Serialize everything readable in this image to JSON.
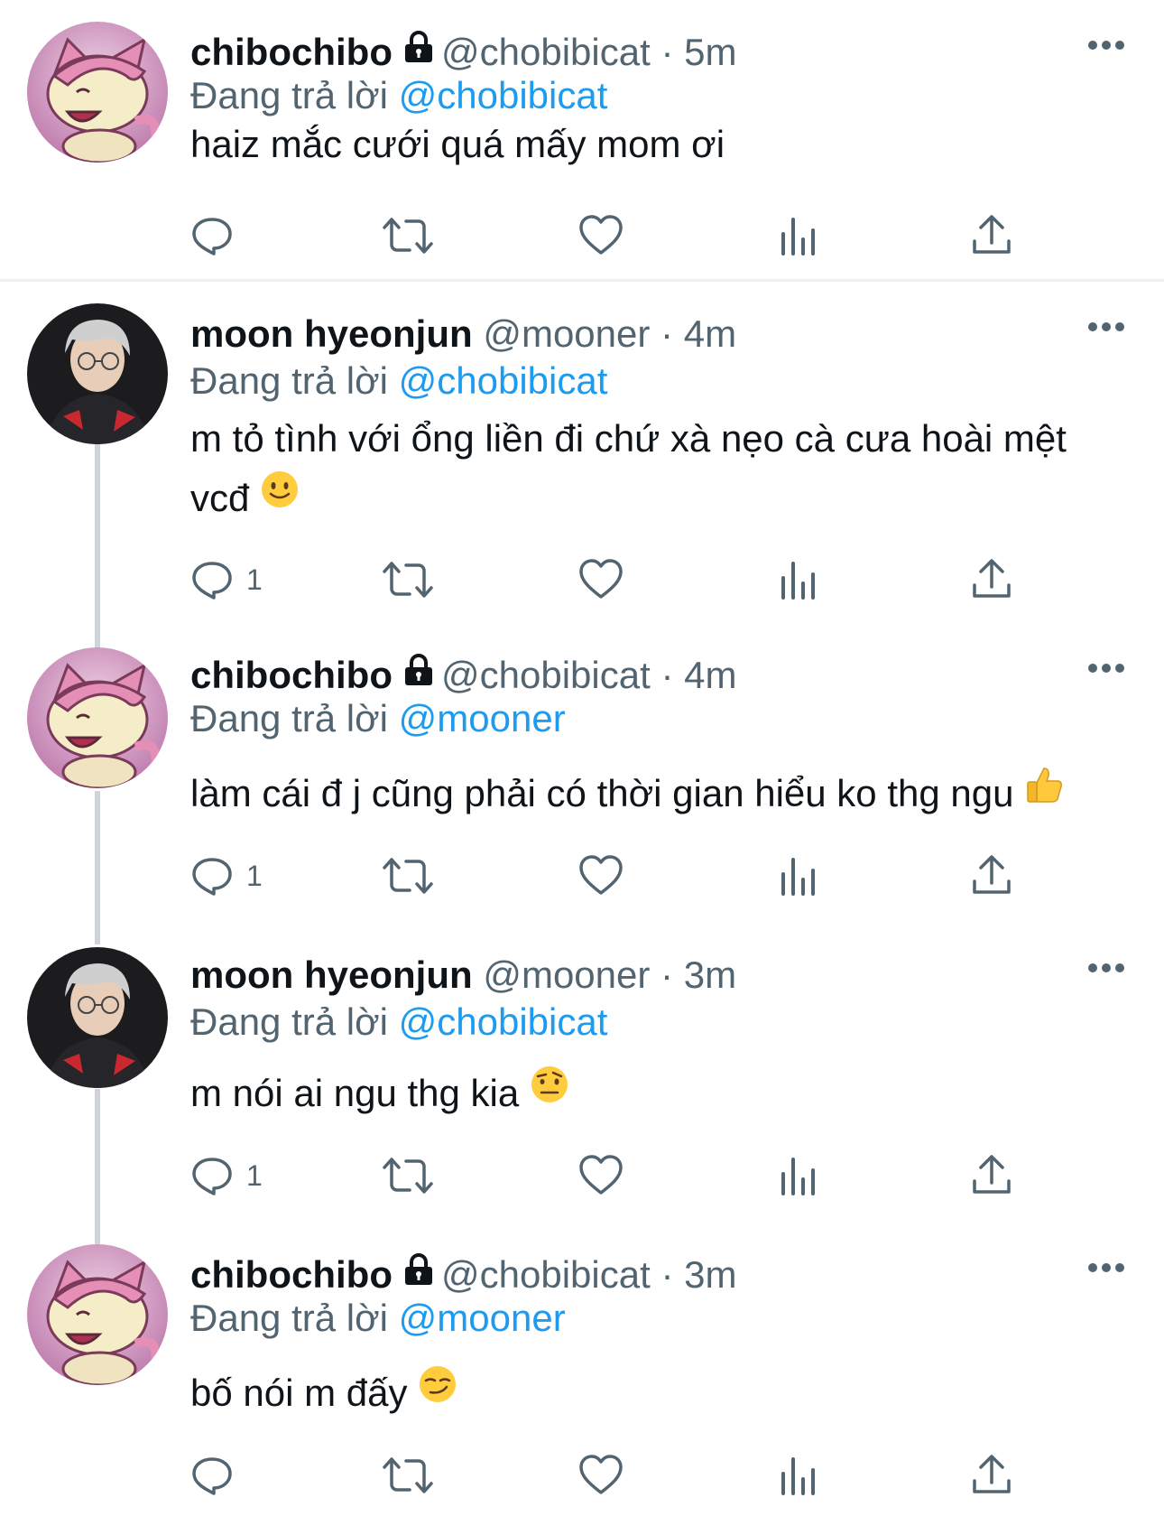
{
  "tweets": [
    {
      "name": "chibochibo",
      "locked": true,
      "handle": "@chobibicat",
      "separator": "·",
      "time": "5m",
      "reply_label": "Đang trả lời",
      "reply_to": "@chobibicat",
      "text": "haiz mắc cưới quá mấy mom ơi",
      "emoji": "",
      "reply_count": "",
      "avatar": "pink-cat-pokemon-avatar"
    },
    {
      "name": "moon hyeonjun",
      "locked": false,
      "handle": "@mooner",
      "separator": "·",
      "time": "4m",
      "reply_label": "Đang trả lời",
      "reply_to": "@chobibicat",
      "text": "m tỏ tình với ổng liền đi chứ xà nẹo cà cưa hoài mệt vcđ",
      "emoji": "slightly-smiling-face",
      "reply_count": "1",
      "avatar": "gamer-portrait-avatar"
    },
    {
      "name": "chibochibo",
      "locked": true,
      "handle": "@chobibicat",
      "separator": "·",
      "time": "4m",
      "reply_label": "Đang trả lời",
      "reply_to": "@mooner",
      "text": "làm cái đ j cũng phải có thời gian hiểu ko thg ngu",
      "emoji": "thumbs-up",
      "reply_count": "1",
      "avatar": "pink-cat-pokemon-avatar"
    },
    {
      "name": "moon hyeonjun",
      "locked": false,
      "handle": "@mooner",
      "separator": "·",
      "time": "3m",
      "reply_label": "Đang trả lời",
      "reply_to": "@chobibicat",
      "text": "m nói ai ngu thg kia",
      "emoji": "face-with-raised-eyebrow",
      "reply_count": "1",
      "avatar": "gamer-portrait-avatar"
    },
    {
      "name": "chibochibo",
      "locked": true,
      "handle": "@chobibicat",
      "separator": "·",
      "time": "3m",
      "reply_label": "Đang trả lời",
      "reply_to": "@mooner",
      "text": "bố nói m đấy",
      "emoji": "smirking-face",
      "reply_count": "",
      "avatar": "pink-cat-pokemon-avatar"
    }
  ],
  "icons": {
    "reply": "reply-icon",
    "retweet": "retweet-icon",
    "like": "heart-icon",
    "views": "views-icon",
    "share": "share-icon",
    "more": "more-icon",
    "lock": "lock-icon"
  },
  "colors": {
    "link": "#1d9bf0",
    "secondary_text": "#536471",
    "primary_text": "#0f1419",
    "thread_line": "#d0d4d8",
    "cat_pink": "#e58fb6"
  }
}
